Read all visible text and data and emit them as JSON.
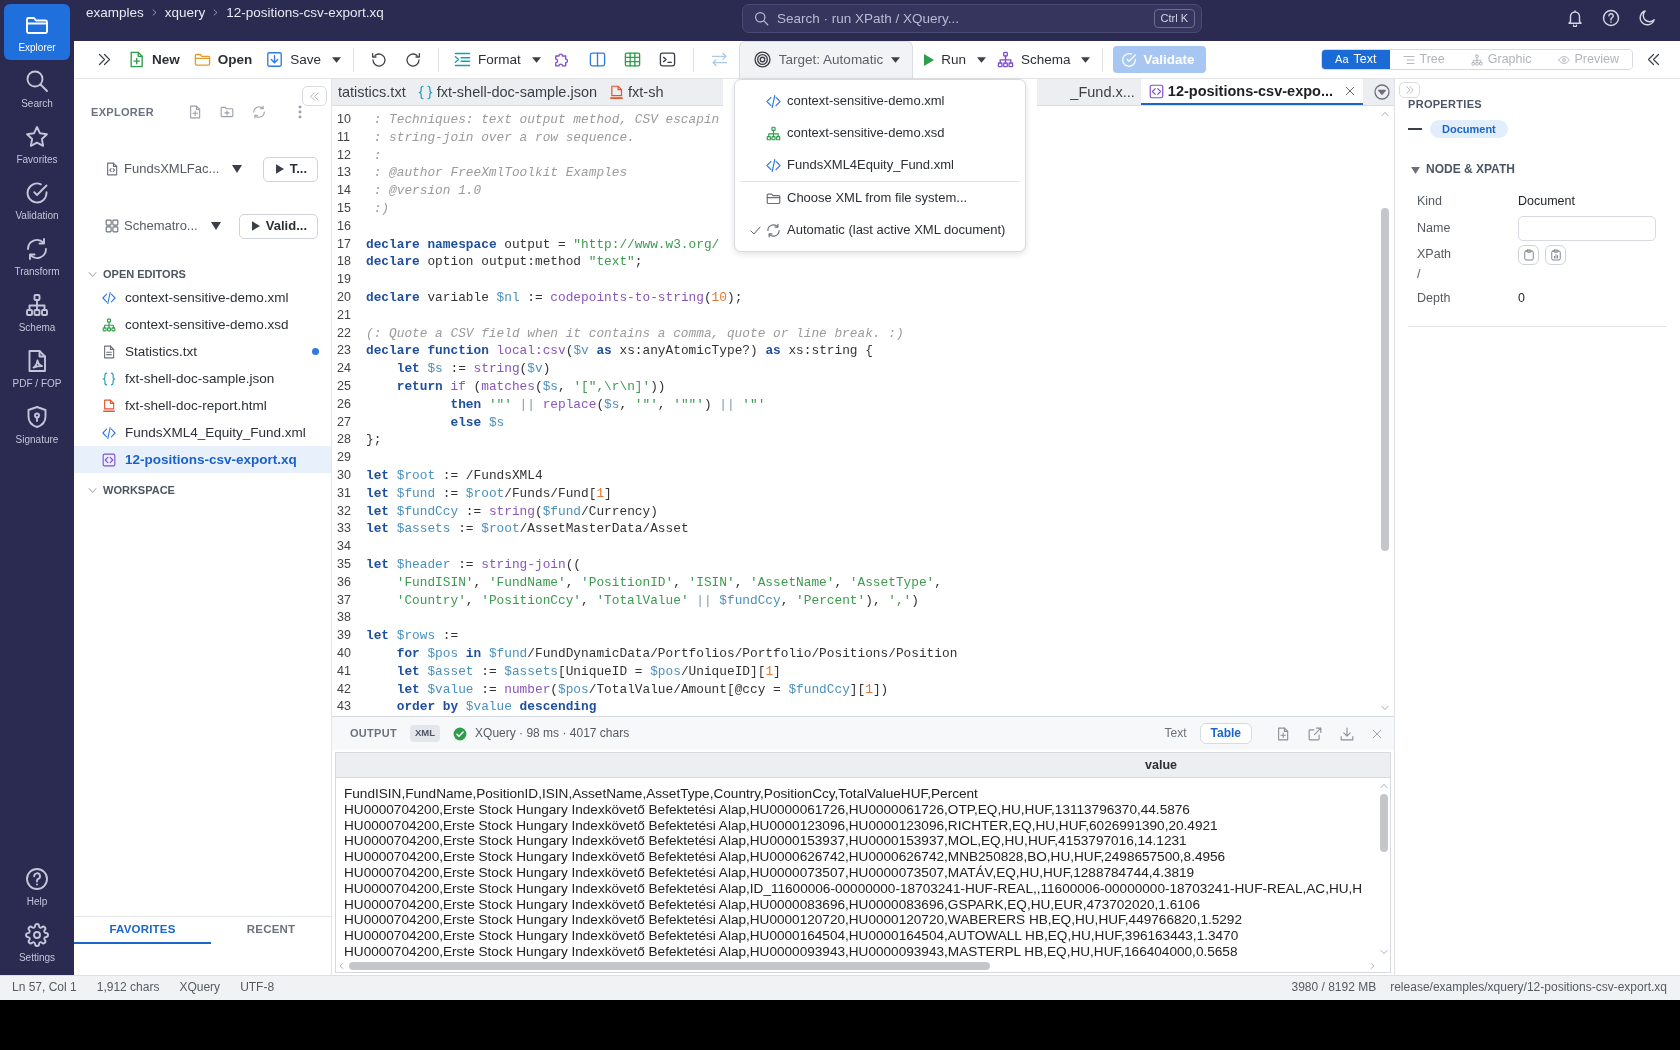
{
  "header": {
    "breadcrumb": [
      "examples",
      "xquery",
      "12-positions-csv-export.xq"
    ],
    "search": {
      "placeholder": "Search · run XPath / XQuery...",
      "shortcut": "Ctrl K"
    }
  },
  "activity_bar": {
    "items": [
      {
        "label": "Explorer",
        "selected": true
      },
      {
        "label": "Search",
        "selected": false
      },
      {
        "label": "Favorites",
        "selected": false
      },
      {
        "label": "Validation",
        "selected": false
      },
      {
        "label": "Transform",
        "selected": false
      },
      {
        "label": "Schema",
        "selected": false
      },
      {
        "label": "PDF / FOP",
        "selected": false
      },
      {
        "label": "Signature",
        "selected": false
      }
    ],
    "bottom_items": [
      {
        "label": "Help"
      },
      {
        "label": "Settings"
      }
    ]
  },
  "toolbar": {
    "new_button": "New",
    "open_button": "Open",
    "save_button": "Save",
    "format_button": "Format",
    "swap_button": {
      "disabled": true
    },
    "target_button": {
      "label": "Target: Automatic",
      "expanded": true
    },
    "run_button": "Run",
    "schema_button": "Schema",
    "validate_button": {
      "label": "Validate",
      "disabled": true
    },
    "view_modes": [
      {
        "glyph": "Aa",
        "label": "Text",
        "selected": true,
        "disabled": false
      },
      {
        "label": "Tree",
        "selected": false,
        "disabled": true
      },
      {
        "label": "Graphic",
        "selected": false,
        "disabled": true
      },
      {
        "label": "Preview",
        "selected": false,
        "disabled": true
      }
    ]
  },
  "target_menu": {
    "documents": [
      {
        "kind": "xml",
        "label": "context-sensitive-demo.xml",
        "checked": false
      },
      {
        "kind": "xsd",
        "label": "context-sensitive-demo.xsd",
        "checked": false
      },
      {
        "kind": "xml",
        "label": "FundsXML4Equity_Fund.xml",
        "checked": false
      }
    ],
    "actions": [
      {
        "kind": "browse",
        "label": "Choose XML from file system...",
        "checked": false
      },
      {
        "kind": "auto",
        "label": "Automatic (last active XML document)",
        "checked": true
      }
    ]
  },
  "explorer": {
    "title": "EXPLORER",
    "pickers": [
      {
        "label": "FundsXMLFac...",
        "button": "T..."
      },
      {
        "label": "Schematro...",
        "button": "Valid..."
      }
    ],
    "sections": [
      {
        "title": "OPEN EDITORS",
        "expanded": true,
        "items": [
          {
            "kind": "xml",
            "label": "context-sensitive-demo.xml",
            "selected": false,
            "modified": false
          },
          {
            "kind": "xsd",
            "label": "context-sensitive-demo.xsd",
            "selected": false,
            "modified": false
          },
          {
            "kind": "text",
            "label": "Statistics.txt",
            "selected": false,
            "modified": true
          },
          {
            "kind": "json",
            "label": "fxt-shell-doc-sample.json",
            "selected": false,
            "modified": false
          },
          {
            "kind": "html",
            "label": "fxt-shell-doc-report.html",
            "selected": false,
            "modified": false
          },
          {
            "kind": "xml",
            "label": "FundsXML4_Equity_Fund.xml",
            "selected": false,
            "modified": false
          },
          {
            "kind": "xquery",
            "label": "12-positions-csv-export.xq",
            "selected": true,
            "modified": false
          }
        ]
      },
      {
        "title": "WORKSPACE",
        "expanded": true
      }
    ],
    "bottom_tabs": [
      {
        "label": "FAVORITES",
        "selected": true
      },
      {
        "label": "RECENT",
        "selected": false
      }
    ]
  },
  "editor": {
    "tabs": [
      {
        "label": "tatistics.txt",
        "selected": false
      },
      {
        "kind": "json",
        "label": "fxt-shell-doc-sample.json",
        "selected": false
      },
      {
        "kind": "html",
        "label": "fxt-sh",
        "selected": false
      },
      {
        "label": "_Fund.x...",
        "selected": false
      },
      {
        "kind": "xquery",
        "label": "12-positions-csv-expo...",
        "selected": true
      }
    ],
    "lines": [
      {
        "number": "10",
        "tokens": [
          {
            "kind": "comment",
            "text": " : Techniques: text output method, CSV escapin"
          }
        ]
      },
      {
        "number": "11",
        "tokens": [
          {
            "kind": "comment",
            "text": " : string-join over a row sequence."
          }
        ]
      },
      {
        "number": "12",
        "tokens": [
          {
            "kind": "comment",
            "text": " :"
          }
        ]
      },
      {
        "number": "13",
        "tokens": [
          {
            "kind": "comment",
            "text": " : @author FreeXmlToolkit Examples"
          }
        ]
      },
      {
        "number": "14",
        "tokens": [
          {
            "kind": "comment",
            "text": " : @version 1.0"
          }
        ]
      },
      {
        "number": "15",
        "tokens": [
          {
            "kind": "comment",
            "text": " :)"
          }
        ]
      },
      {
        "number": "16"
      },
      {
        "number": "17",
        "tokens": [
          {
            "kind": "keyword",
            "text": "declare"
          },
          {
            "kind": "keyword",
            "text": " namespace"
          },
          {
            "kind": "plain",
            "text": " output = "
          },
          {
            "kind": "string",
            "text": "\"http://www.w3.org/"
          }
        ]
      },
      {
        "number": "18",
        "tokens": [
          {
            "kind": "keyword",
            "text": "declare"
          },
          {
            "kind": "plain",
            "text": " option output:method "
          },
          {
            "kind": "string",
            "text": "\"text\""
          },
          {
            "kind": "plain",
            "text": ";"
          }
        ]
      },
      {
        "number": "19"
      },
      {
        "number": "20",
        "tokens": [
          {
            "kind": "keyword",
            "text": "declare"
          },
          {
            "kind": "plain",
            "text": " variable "
          },
          {
            "kind": "variable",
            "text": "$nl"
          },
          {
            "kind": "plain",
            "text": " := "
          },
          {
            "kind": "function",
            "text": "codepoints-to-string"
          },
          {
            "kind": "plain",
            "text": "("
          },
          {
            "kind": "number",
            "text": "10"
          },
          {
            "kind": "plain",
            "text": ");"
          }
        ]
      },
      {
        "number": "21"
      },
      {
        "number": "22",
        "tokens": [
          {
            "kind": "comment",
            "text": "(: Quote a CSV field when it contains a comma, quote or line break. :)"
          }
        ]
      },
      {
        "number": "23",
        "tokens": [
          {
            "kind": "keyword",
            "text": "declare"
          },
          {
            "kind": "keyword",
            "text": " function"
          },
          {
            "kind": "function",
            "text": " local:csv"
          },
          {
            "kind": "plain",
            "text": "("
          },
          {
            "kind": "variable",
            "text": "$v"
          },
          {
            "kind": "keyword",
            "text": " as"
          },
          {
            "kind": "plain",
            "text": " xs:anyAtomicType?) "
          },
          {
            "kind": "keyword",
            "text": "as"
          },
          {
            "kind": "plain",
            "text": " xs:string {"
          }
        ]
      },
      {
        "number": "24",
        "tokens": [
          {
            "kind": "keyword",
            "text": "    let"
          },
          {
            "kind": "variable",
            "text": " $s"
          },
          {
            "kind": "plain",
            "text": " := "
          },
          {
            "kind": "function",
            "text": "string"
          },
          {
            "kind": "plain",
            "text": "("
          },
          {
            "kind": "variable",
            "text": "$v"
          },
          {
            "kind": "plain",
            "text": ")"
          }
        ]
      },
      {
        "number": "25",
        "tokens": [
          {
            "kind": "keyword",
            "text": "    return"
          },
          {
            "kind": "function",
            "text": " if"
          },
          {
            "kind": "plain",
            "text": " ("
          },
          {
            "kind": "function",
            "text": "matches"
          },
          {
            "kind": "plain",
            "text": "("
          },
          {
            "kind": "variable",
            "text": "$s"
          },
          {
            "kind": "plain",
            "text": ", "
          },
          {
            "kind": "string",
            "text": "'[\",\\r\\n]'"
          },
          {
            "kind": "plain",
            "text": "))"
          }
        ]
      },
      {
        "number": "26",
        "tokens": [
          {
            "kind": "keyword",
            "text": "           then"
          },
          {
            "kind": "string",
            "text": " '\"'"
          },
          {
            "kind": "operator",
            "text": " ||"
          },
          {
            "kind": "function",
            "text": " replace"
          },
          {
            "kind": "plain",
            "text": "("
          },
          {
            "kind": "variable",
            "text": "$s"
          },
          {
            "kind": "plain",
            "text": ", "
          },
          {
            "kind": "string",
            "text": "'\"'"
          },
          {
            "kind": "plain",
            "text": ", "
          },
          {
            "kind": "string",
            "text": "'\"\"'"
          },
          {
            "kind": "plain",
            "text": ") "
          },
          {
            "kind": "operator",
            "text": "||"
          },
          {
            "kind": "string",
            "text": " '\"'"
          }
        ]
      },
      {
        "number": "27",
        "tokens": [
          {
            "kind": "keyword",
            "text": "           else"
          },
          {
            "kind": "variable",
            "text": " $s"
          }
        ]
      },
      {
        "number": "28",
        "tokens": [
          {
            "kind": "plain",
            "text": "};"
          }
        ]
      },
      {
        "number": "29"
      },
      {
        "number": "30",
        "tokens": [
          {
            "kind": "keyword",
            "text": "let"
          },
          {
            "kind": "variable",
            "text": " $root"
          },
          {
            "kind": "plain",
            "text": " := /FundsXML4"
          }
        ]
      },
      {
        "number": "31",
        "tokens": [
          {
            "kind": "keyword",
            "text": "let"
          },
          {
            "kind": "variable",
            "text": " $fund"
          },
          {
            "kind": "plain",
            "text": " := "
          },
          {
            "kind": "variable",
            "text": "$root"
          },
          {
            "kind": "plain",
            "text": "/Funds/Fund["
          },
          {
            "kind": "number",
            "text": "1"
          },
          {
            "kind": "plain",
            "text": "]"
          }
        ]
      },
      {
        "number": "32",
        "tokens": [
          {
            "kind": "keyword",
            "text": "let"
          },
          {
            "kind": "variable",
            "text": " $fundCcy"
          },
          {
            "kind": "plain",
            "text": " := "
          },
          {
            "kind": "function",
            "text": "string"
          },
          {
            "kind": "plain",
            "text": "("
          },
          {
            "kind": "variable",
            "text": "$fund"
          },
          {
            "kind": "plain",
            "text": "/Currency)"
          }
        ]
      },
      {
        "number": "33",
        "tokens": [
          {
            "kind": "keyword",
            "text": "let"
          },
          {
            "kind": "variable",
            "text": " $assets"
          },
          {
            "kind": "plain",
            "text": " := "
          },
          {
            "kind": "variable",
            "text": "$root"
          },
          {
            "kind": "plain",
            "text": "/AssetMasterData/Asset"
          }
        ]
      },
      {
        "number": "34"
      },
      {
        "number": "35",
        "tokens": [
          {
            "kind": "keyword",
            "text": "let"
          },
          {
            "kind": "variable",
            "text": " $header"
          },
          {
            "kind": "plain",
            "text": " := "
          },
          {
            "kind": "function",
            "text": "string-join"
          },
          {
            "kind": "plain",
            "text": "(("
          }
        ]
      },
      {
        "number": "36",
        "tokens": [
          {
            "kind": "string",
            "text": "    'FundISIN'"
          },
          {
            "kind": "plain",
            "text": ", "
          },
          {
            "kind": "string",
            "text": "'FundName'"
          },
          {
            "kind": "plain",
            "text": ", "
          },
          {
            "kind": "string",
            "text": "'PositionID'"
          },
          {
            "kind": "plain",
            "text": ", "
          },
          {
            "kind": "string",
            "text": "'ISIN'"
          },
          {
            "kind": "plain",
            "text": ", "
          },
          {
            "kind": "string",
            "text": "'AssetName'"
          },
          {
            "kind": "plain",
            "text": ", "
          },
          {
            "kind": "string",
            "text": "'AssetType'"
          },
          {
            "kind": "plain",
            "text": ","
          }
        ]
      },
      {
        "number": "37",
        "tokens": [
          {
            "kind": "string",
            "text": "    'Country'"
          },
          {
            "kind": "plain",
            "text": ", "
          },
          {
            "kind": "string",
            "text": "'PositionCcy'"
          },
          {
            "kind": "plain",
            "text": ", "
          },
          {
            "kind": "string",
            "text": "'TotalValue'"
          },
          {
            "kind": "operator",
            "text": " ||"
          },
          {
            "kind": "variable",
            "text": " $fundCcy"
          },
          {
            "kind": "plain",
            "text": ", "
          },
          {
            "kind": "string",
            "text": "'Percent'"
          },
          {
            "kind": "plain",
            "text": "), "
          },
          {
            "kind": "string",
            "text": "','"
          },
          {
            "kind": "plain",
            "text": ")"
          }
        ]
      },
      {
        "number": "38"
      },
      {
        "number": "39",
        "tokens": [
          {
            "kind": "keyword",
            "text": "let"
          },
          {
            "kind": "variable",
            "text": " $rows"
          },
          {
            "kind": "plain",
            "text": " :="
          }
        ]
      },
      {
        "number": "40",
        "tokens": [
          {
            "kind": "keyword",
            "text": "    for"
          },
          {
            "kind": "variable",
            "text": " $pos"
          },
          {
            "kind": "keyword",
            "text": " in"
          },
          {
            "kind": "variable",
            "text": " $fund"
          },
          {
            "kind": "plain",
            "text": "/FundDynamicData/Portfolios/Portfolio/Positions/Position"
          }
        ]
      },
      {
        "number": "41",
        "tokens": [
          {
            "kind": "keyword",
            "text": "    let"
          },
          {
            "kind": "variable",
            "text": " $asset"
          },
          {
            "kind": "plain",
            "text": " := "
          },
          {
            "kind": "variable",
            "text": "$assets"
          },
          {
            "kind": "plain",
            "text": "[UniqueID = "
          },
          {
            "kind": "variable",
            "text": "$pos"
          },
          {
            "kind": "plain",
            "text": "/UniqueID]["
          },
          {
            "kind": "number",
            "text": "1"
          },
          {
            "kind": "plain",
            "text": "]"
          }
        ]
      },
      {
        "number": "42",
        "tokens": [
          {
            "kind": "keyword",
            "text": "    let"
          },
          {
            "kind": "variable",
            "text": " $value"
          },
          {
            "kind": "plain",
            "text": " := "
          },
          {
            "kind": "function",
            "text": "number"
          },
          {
            "kind": "plain",
            "text": "("
          },
          {
            "kind": "variable",
            "text": "$pos"
          },
          {
            "kind": "plain",
            "text": "/TotalValue/Amount[@ccy = "
          },
          {
            "kind": "variable",
            "text": "$fundCcy"
          },
          {
            "kind": "plain",
            "text": "]["
          },
          {
            "kind": "number",
            "text": "1"
          },
          {
            "kind": "plain",
            "text": "])"
          }
        ]
      },
      {
        "number": "43",
        "tokens": [
          {
            "kind": "keyword",
            "text": "    order by"
          },
          {
            "kind": "variable",
            "text": " $value"
          },
          {
            "kind": "keyword",
            "text": " descending"
          }
        ]
      }
    ]
  },
  "output": {
    "title": "OUTPUT",
    "format": "XML",
    "status": {
      "ok": true,
      "text": "XQuery · 98 ms · 4017 chars"
    },
    "view_modes": [
      {
        "label": "Text",
        "selected": false
      },
      {
        "label": "Table",
        "selected": true
      }
    ],
    "table": {
      "columns": [
        "value"
      ],
      "lines": [
        "FundISIN,FundName,PositionID,ISIN,AssetName,AssetType,Country,PositionCcy,TotalValueHUF,Percent",
        "HU0000704200,Erste Stock Hungary Indexkövető Befektetési Alap,HU0000061726,HU0000061726,OTP,EQ,HU,HUF,13113796370,44.5876",
        "HU0000704200,Erste Stock Hungary Indexkövető Befektetési Alap,HU0000123096,HU0000123096,RICHTER,EQ,HU,HUF,6026991390,20.4921",
        "HU0000704200,Erste Stock Hungary Indexkövető Befektetési Alap,HU0000153937,HU0000153937,MOL,EQ,HU,HUF,4153797016,14.1231",
        "HU0000704200,Erste Stock Hungary Indexkövető Befektetési Alap,HU0000626742,HU0000626742,MNB250828,BO,HU,HUF,2498657500,8.4956",
        "HU0000704200,Erste Stock Hungary Indexkövető Befektetési Alap,HU0000073507,HU0000073507,MATÁV,EQ,HU,HUF,1288784744,4.3819",
        "HU0000704200,Erste Stock Hungary Indexkövető Befektetési Alap,ID_11600006-00000000-18703241-HUF-REAL,,11600006-00000000-18703241-HUF-REAL,AC,HU,H",
        "HU0000704200,Erste Stock Hungary Indexkövető Befektetési Alap,HU0000083696,HU0000083696,GSPARK,EQ,HU,EUR,473702020,1.6106",
        "HU0000704200,Erste Stock Hungary Indexkövető Befektetési Alap,HU0000120720,HU0000120720,WABERERS HB,EQ,HU,HUF,449766820,1.5292",
        "HU0000704200,Erste Stock Hungary Indexkövető Befektetési Alap,HU0000164504,HU0000164504,AUTOWALL HB,EQ,HU,HUF,396163443,1.3470",
        "HU0000704200,Erste Stock Hungary Indexkövető Befektetési Alap,HU0000093943,HU0000093943,MASTERPL HB,EQ,HU,HUF,166404000,0.5658"
      ]
    }
  },
  "properties": {
    "title": "PROPERTIES",
    "node_type": "Document",
    "section": {
      "title": "NODE & XPATH",
      "expanded": true,
      "fields": [
        {
          "kind": "text",
          "label": "Kind",
          "value": "Document"
        },
        {
          "kind": "input",
          "label": "Name"
        },
        {
          "kind": "xpath",
          "label": "XPath",
          "value": "/"
        },
        {
          "kind": "text",
          "label": "Depth",
          "value": "0"
        }
      ]
    }
  },
  "status_bar": {
    "left": [
      "Ln 57, Col 1",
      "1,912 chars",
      "XQuery",
      "UTF-8"
    ],
    "right": [
      "3980 / 8192 MB",
      "release/examples/xquery/12-positions-csv-export.xq"
    ]
  }
}
